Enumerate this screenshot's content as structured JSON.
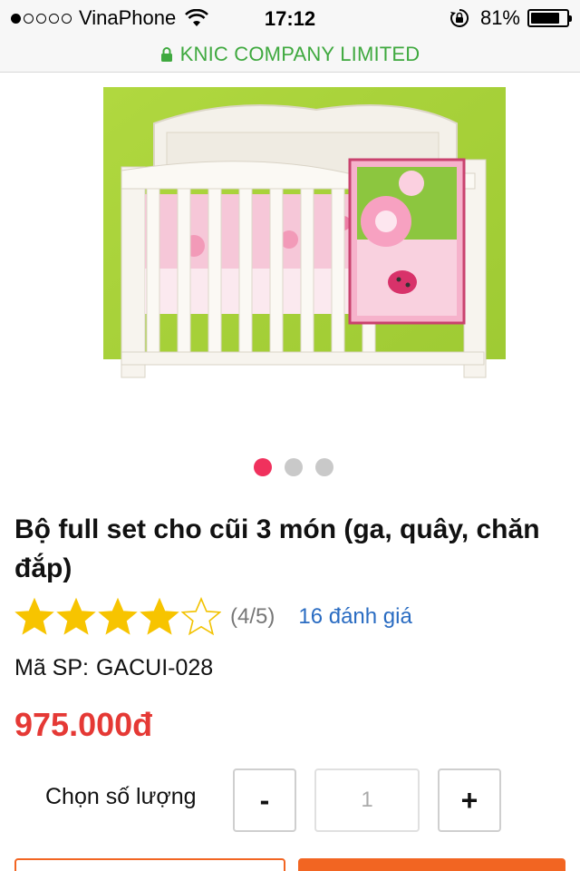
{
  "status_bar": {
    "carrier": "VinaPhone",
    "time": "17:12",
    "battery_percent": "81%",
    "battery_level": 0.81,
    "signal_bars": 1,
    "signal_total": 5
  },
  "url_bar": {
    "site_name": "KNIC COMPANY LIMITED",
    "secure_color": "#3fa93f"
  },
  "carousel": {
    "total": 3,
    "active_index": 0,
    "active_color": "#f0315d"
  },
  "product": {
    "title": "Bộ full set cho cũi 3 món (ga, quây, chăn đắp)",
    "rating": 4,
    "rating_max": 5,
    "rating_text": "(4/5)",
    "review_count": "16 đánh giá",
    "sku_label": "Mã SP:",
    "sku_value": "GACUI-028",
    "price": "975.000đ",
    "price_color": "#e53935"
  },
  "quantity": {
    "label": "Chọn số lượng",
    "minus_label": "-",
    "plus_label": "+",
    "value": "1"
  },
  "colors": {
    "accent": "#f26522",
    "link": "#2a6cc2"
  }
}
